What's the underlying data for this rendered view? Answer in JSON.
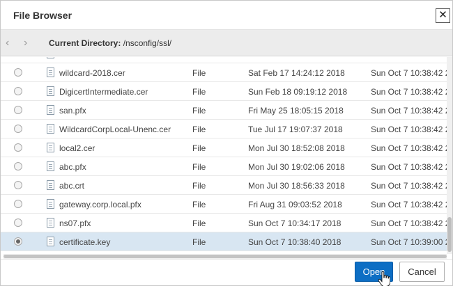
{
  "dialog": {
    "title": "File Browser",
    "close_glyph": "✕"
  },
  "nav": {
    "back_glyph": "‹",
    "forward_glyph": "›",
    "current_directory_label": "Current Directory:",
    "current_directory_path": "/nsconfig/ssl/"
  },
  "files": [
    {
      "name": "wildcard-2018.cer",
      "type": "File",
      "modified": "Sat Feb 17 14:24:12 2018",
      "accessed": "Sun Oct  7 10:38:42 2",
      "selected": false
    },
    {
      "name": "DigicertIntermediate.cer",
      "type": "File",
      "modified": "Sun Feb 18 09:19:12 2018",
      "accessed": "Sun Oct  7 10:38:42 2",
      "selected": false
    },
    {
      "name": "san.pfx",
      "type": "File",
      "modified": "Fri May 25 18:05:15 2018",
      "accessed": "Sun Oct  7 10:38:42 2",
      "selected": false
    },
    {
      "name": "WildcardCorpLocal-Unenc.cer",
      "type": "File",
      "modified": "Tue Jul 17 19:07:37 2018",
      "accessed": "Sun Oct  7 10:38:42 2",
      "selected": false
    },
    {
      "name": "local2.cer",
      "type": "File",
      "modified": "Mon Jul 30 18:52:08 2018",
      "accessed": "Sun Oct  7 10:38:42 2",
      "selected": false
    },
    {
      "name": "abc.pfx",
      "type": "File",
      "modified": "Mon Jul 30 19:02:06 2018",
      "accessed": "Sun Oct  7 10:38:42 2",
      "selected": false
    },
    {
      "name": "abc.crt",
      "type": "File",
      "modified": "Mon Jul 30 18:56:33 2018",
      "accessed": "Sun Oct  7 10:38:42 2",
      "selected": false
    },
    {
      "name": "gateway.corp.local.pfx",
      "type": "File",
      "modified": "Fri Aug 31 09:03:52 2018",
      "accessed": "Sun Oct  7 10:38:42 2",
      "selected": false
    },
    {
      "name": "ns07.pfx",
      "type": "File",
      "modified": "Sun Oct  7 10:34:17 2018",
      "accessed": "Sun Oct  7 10:38:42 2",
      "selected": false
    },
    {
      "name": "certificate.key",
      "type": "File",
      "modified": "Sun Oct  7 10:38:40 2018",
      "accessed": "Sun Oct  7 10:39:00 2",
      "selected": true
    }
  ],
  "footer": {
    "open_label": "Open",
    "cancel_label": "Cancel"
  },
  "colors": {
    "primary_button": "#0d6ec4",
    "selected_row": "#d8e6f2"
  },
  "icons": {
    "file": "file-icon",
    "close": "close-icon",
    "back": "chevron-left-icon",
    "forward": "chevron-right-icon",
    "cursor": "hand-pointer-icon"
  }
}
